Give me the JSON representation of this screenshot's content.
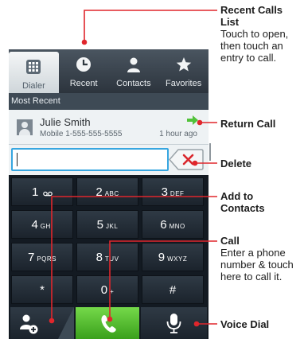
{
  "tabs": [
    {
      "label": "Dialer",
      "icon": "dialpad-grid-icon"
    },
    {
      "label": "Recent",
      "icon": "clock-icon"
    },
    {
      "label": "Contacts",
      "icon": "person-icon"
    },
    {
      "label": "Favorites",
      "icon": "star-icon"
    }
  ],
  "section_header": "Most Recent",
  "recent_entry": {
    "name": "Julie Smith",
    "number": "Mobile 1-555-555-5555",
    "time": "1 hour ago"
  },
  "number_field": {
    "value": ""
  },
  "keypad": [
    {
      "digit": "1",
      "letters": ""
    },
    {
      "digit": "2",
      "letters": "ABC"
    },
    {
      "digit": "3",
      "letters": "DEF"
    },
    {
      "digit": "4",
      "letters": "GHI"
    },
    {
      "digit": "5",
      "letters": "JKL"
    },
    {
      "digit": "6",
      "letters": "MNO"
    },
    {
      "digit": "7",
      "letters": "PQRS"
    },
    {
      "digit": "8",
      "letters": "TUV"
    },
    {
      "digit": "9",
      "letters": "WXYZ"
    },
    {
      "digit": "*",
      "letters": ""
    },
    {
      "digit": "0",
      "letters": "+"
    },
    {
      "digit": "#",
      "letters": ""
    }
  ],
  "bottom_buttons": [
    "add-contact-icon",
    "phone-handset-icon",
    "microphone-icon"
  ],
  "annotations": {
    "recent_title": "Recent Calls List",
    "recent_body": "Touch to open, then touch an entry to call.",
    "return_call": "Return Call",
    "delete": "Delete",
    "add_to_contacts": "Add to Contacts",
    "call_title": "Call",
    "call_body": "Enter a phone number & touch here to call it.",
    "voice_dial": "Voice Dial"
  },
  "colors": {
    "call_green": "#4cc42c",
    "return_arrow": "#52c23a",
    "delete_red": "#d9262c",
    "field_border": "#37a6e0"
  }
}
